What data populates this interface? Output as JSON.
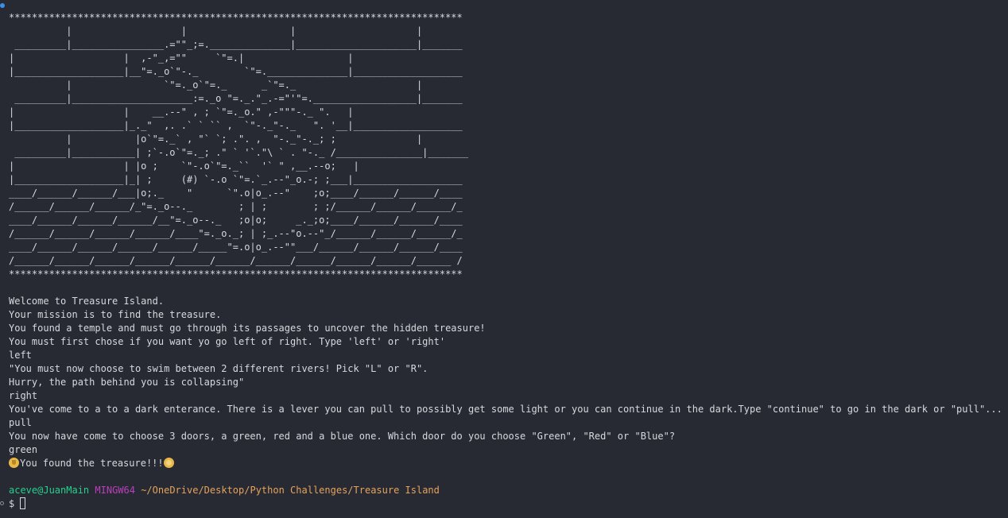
{
  "terminal": {
    "art_lines": [
      "*******************************************************************************",
      "          |                   |                  |                     |",
      " _________|________________.=\"\"_;=.______________|_____________________|_______",
      "|                   |  ,-\"_,=\"\"     `\"=.|                  |",
      "|___________________|__\"=._o`\"-._        `\"=.______________|___________________",
      "          |                `\"=._o`\"=._      _`\"=._                     |",
      " _________|_____________________:=._o \"=._.\"_.-=\"'\"=.__________________|_______",
      "|                   |    __.--\" , ; `\"=._o.\" ,-\"\"\"-._ \".   |",
      "|___________________|_._\"  ,. .` ` `` ,  `\"-._\"-._   \". '__|___________________",
      "          |           |o`\"=._` , \"` `; .\". ,  \"-._\"-._; ;              |",
      " _________|___________| ;`-.o`\"=._; .\" ` '`.\"\\ ` . \"-._ /_______________|_______",
      "|                   | |o ;    `\"-.o`\"=._``  '` \" ,__.--o;   |",
      "|___________________|_| ;     (#) `-.o `\"=.`_.--\"_o.-; ;___|___________________",
      "____/______/______/___|o;._    \"      `\".o|o_.--\"    ;o;____/______/______/____",
      "/______/______/______/_\"=._o--._        ; | ;        ; ;/______/______/______/_",
      "____/______/______/______/__\"=._o--._   ;o|o;     _._;o;____/______/______/____",
      "/______/______/______/______/____\"=._o._; | ;_.--\"o.--\"_/______/______/______/_",
      "____/______/______/______/______/_____\"=.o|o_.--\"\"___/______/______/______/____",
      "/______/______/______/______/______/______/______/______/______/______/______ /",
      "*******************************************************************************"
    ],
    "output_lines": [
      "Welcome to Treasure Island.",
      "Your mission is to find the treasure.",
      "You found a temple and must go through its passages to uncover the hidden treasure!",
      "You must first chose if you want yo go left of right. Type 'left' or 'right'",
      "left",
      "\"You must now choose to swim between 2 different rivers! Pick \"L\" or \"R\".",
      "Hurry, the path behind you is collapsing\"",
      "right",
      "You've come to a to a dark enterance. There is a lever you can pull to possibly get some light or you can continue in the dark.Type \"continue\" to go in the dark or \"pull\"...",
      "pull",
      "You now have come to choose 3 doors, a green, red and a blue one. Which door do you choose \"Green\", \"Red\" or \"Blue\"?",
      "green"
    ],
    "result_text": "You found the treasure!!!",
    "prompt": {
      "user_host": "aceve@JuanMain",
      "system": "MINGW64",
      "path": "~/OneDrive/Desktop/Python Challenges/Treasure Island",
      "symbol": "$"
    },
    "colors": {
      "background": "#272a33",
      "text": "#d6d9dd",
      "user": "#23d18b",
      "system": "#bc3fbc",
      "path": "#e5a35c"
    }
  }
}
